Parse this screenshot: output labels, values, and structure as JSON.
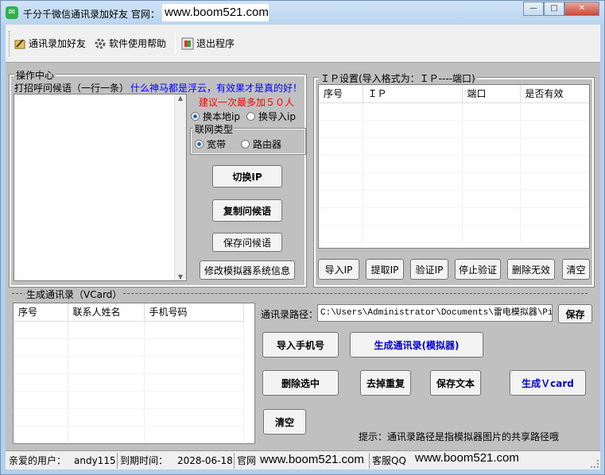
{
  "window": {
    "title": "千分千微信通讯录加好友 官网：",
    "title_url": "www.boom521.com",
    "controls": {
      "minimize": "—",
      "maximize": "□",
      "close": "✕"
    }
  },
  "toolbar": {
    "contacts_add": "通讯录加好友",
    "help": "软件使用帮助",
    "exit": "退出程序"
  },
  "ops": {
    "group_title": "操作中心",
    "greeting_label": "打招呼问候语（一行一条）",
    "greeting_tip": "什么神马都是浮云，有效果才是真的好！",
    "suggest": "建议一次最多加５０人",
    "radio_local_ip": "换本地ip",
    "radio_import_ip": "换导入ip",
    "net_type_label": "联网类型",
    "radio_broadband": "宽带",
    "radio_router": "路由器",
    "switch_ip": "切换IP",
    "copy_greeting": "复制问候语",
    "save_greeting": "保存问候语",
    "modify_emulator": "修改模拟器系统信息"
  },
  "ip": {
    "group_title": "ＩＰ设置(导入格式为：ＩＰ----端口)",
    "columns": [
      "序号",
      "ＩＰ",
      "端口",
      "是否有效"
    ],
    "buttons": [
      "导入IP",
      "提取IP",
      "验证IP",
      "停止验证",
      "删除无效",
      "清空"
    ]
  },
  "vcard": {
    "group_title": "生成通讯录（VCard）",
    "columns": [
      "序号",
      "联系人姓名",
      "手机号码"
    ],
    "path_label": "通讯录路径：",
    "path_value": "C:\\Users\\Administrator\\Documents\\雷电模拟器\\Pictu",
    "save": "保存",
    "import_phone": "导入手机号",
    "gen_emulator": "生成通讯录(模拟器)",
    "delete_selected": "删除选中",
    "dedupe": "去掉重复",
    "save_text": "保存文本",
    "gen_vcard": "生成Ｖcard",
    "clear": "清空",
    "tip": "提示：通讯录路径是指模拟器图片的共享路径哦"
  },
  "status": {
    "user_label": "亲爱的用户：",
    "user_value": "andy115",
    "expire_label": "到期时间：",
    "expire_value": "2028-06-18",
    "site_label": "官网",
    "site_value": "www.boom521.com",
    "qq_label": "客服QQ",
    "qq_value": "www.boom521.com"
  },
  "colors": {
    "tip_blue": "#0000ff",
    "suggest_red": "#ff0000",
    "button_blue_text": "#0000cc"
  }
}
